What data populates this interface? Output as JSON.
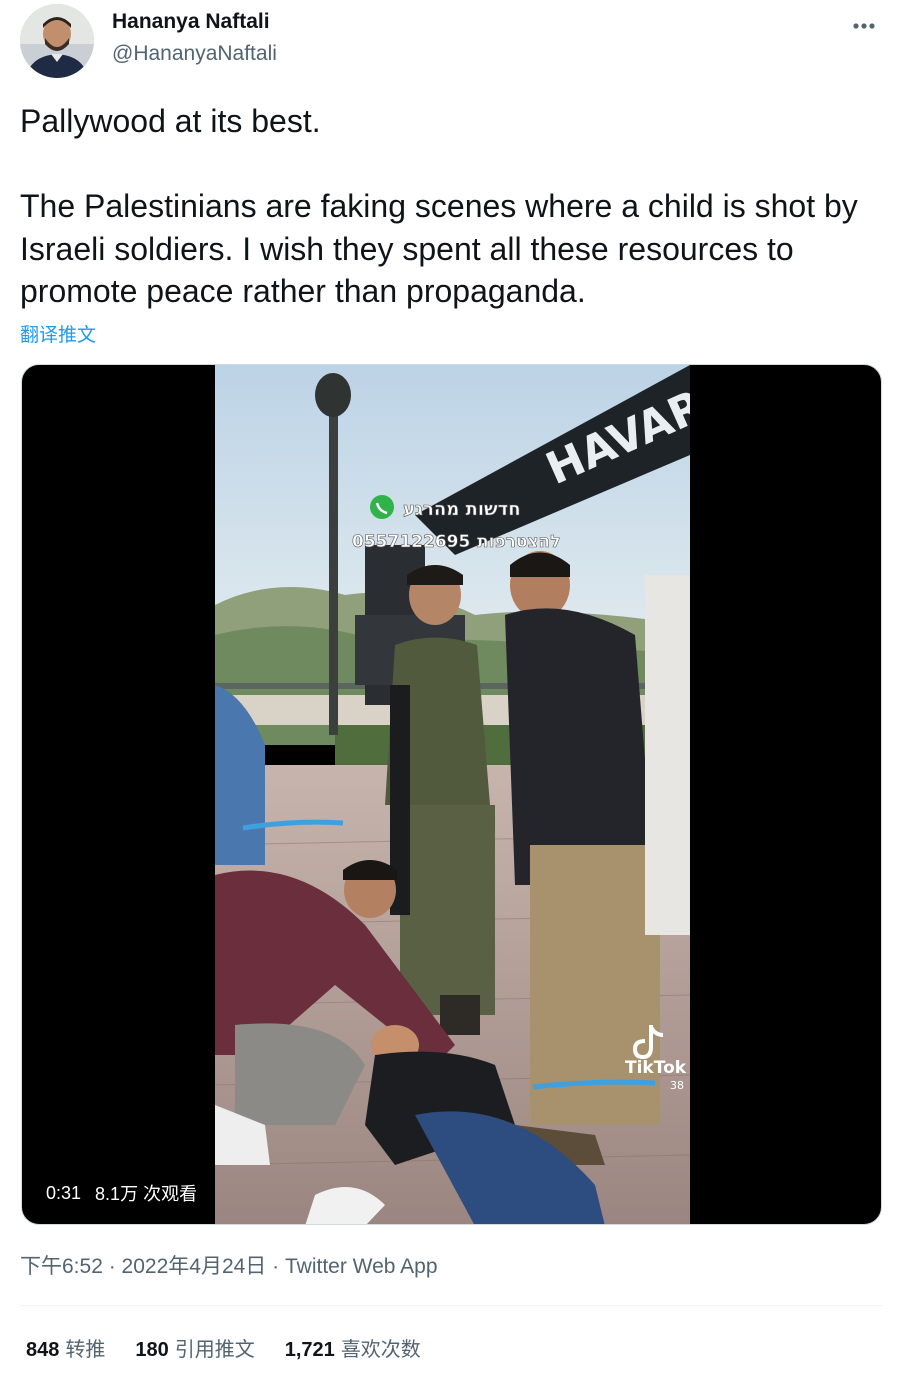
{
  "author": {
    "name": "Hananya Naftali",
    "handle": "@HananyaNaftali"
  },
  "tweet": {
    "paragraphs": [
      "Pallywood at its best.",
      "The Palestinians are faking scenes where a child is shot by Israeli soldiers. I wish they spent all these resources to promote peace rather than propaganda."
    ],
    "translate_label": "翻译推文"
  },
  "media": {
    "duration": "0:31",
    "views": "8.1万 次观看",
    "overlay": {
      "hebrew_top": "חדשות מהרגע",
      "phone": "0557122695",
      "hebrew_join": "להצטרפות",
      "crane_text": "HAVAR",
      "watermark": "TikTok",
      "watermark_num": "38"
    }
  },
  "meta": {
    "time": "下午6:52",
    "date": "2022年4月24日",
    "separator": " · ",
    "source": "Twitter Web App"
  },
  "stats": {
    "retweets": {
      "value": "848",
      "label": "转推"
    },
    "quotes": {
      "value": "180",
      "label": "引用推文"
    },
    "likes": {
      "value": "1,721",
      "label": "喜欢次数"
    }
  },
  "colors": {
    "link": "#1d9bf0",
    "secondary_text": "#536471",
    "primary_text": "#0f1419",
    "divider": "#eff3f4"
  },
  "icons": {
    "more": "more-horizontal-icon",
    "whatsapp": "whatsapp-icon",
    "tiktok": "tiktok-icon"
  }
}
